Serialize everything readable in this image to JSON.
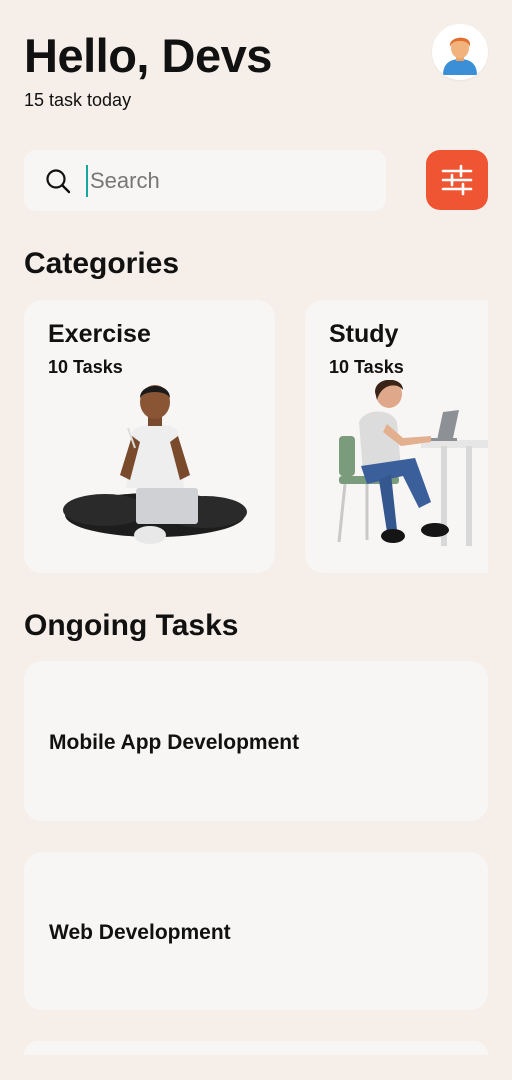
{
  "header": {
    "greeting": "Hello, Devs",
    "subtitle": "15 task today"
  },
  "avatar": {
    "icon": "user-avatar-icon"
  },
  "search": {
    "placeholder": "Search"
  },
  "filter": {
    "icon": "sliders-icon",
    "color": "#F05533"
  },
  "categories": {
    "title": "Categories",
    "items": [
      {
        "name": "Exercise",
        "count": "10 Tasks"
      },
      {
        "name": "Study",
        "count": "10 Tasks"
      }
    ]
  },
  "ongoing": {
    "title": "Ongoing Tasks",
    "items": [
      {
        "title": "Mobile App Development"
      },
      {
        "title": "Web Development"
      }
    ]
  }
}
